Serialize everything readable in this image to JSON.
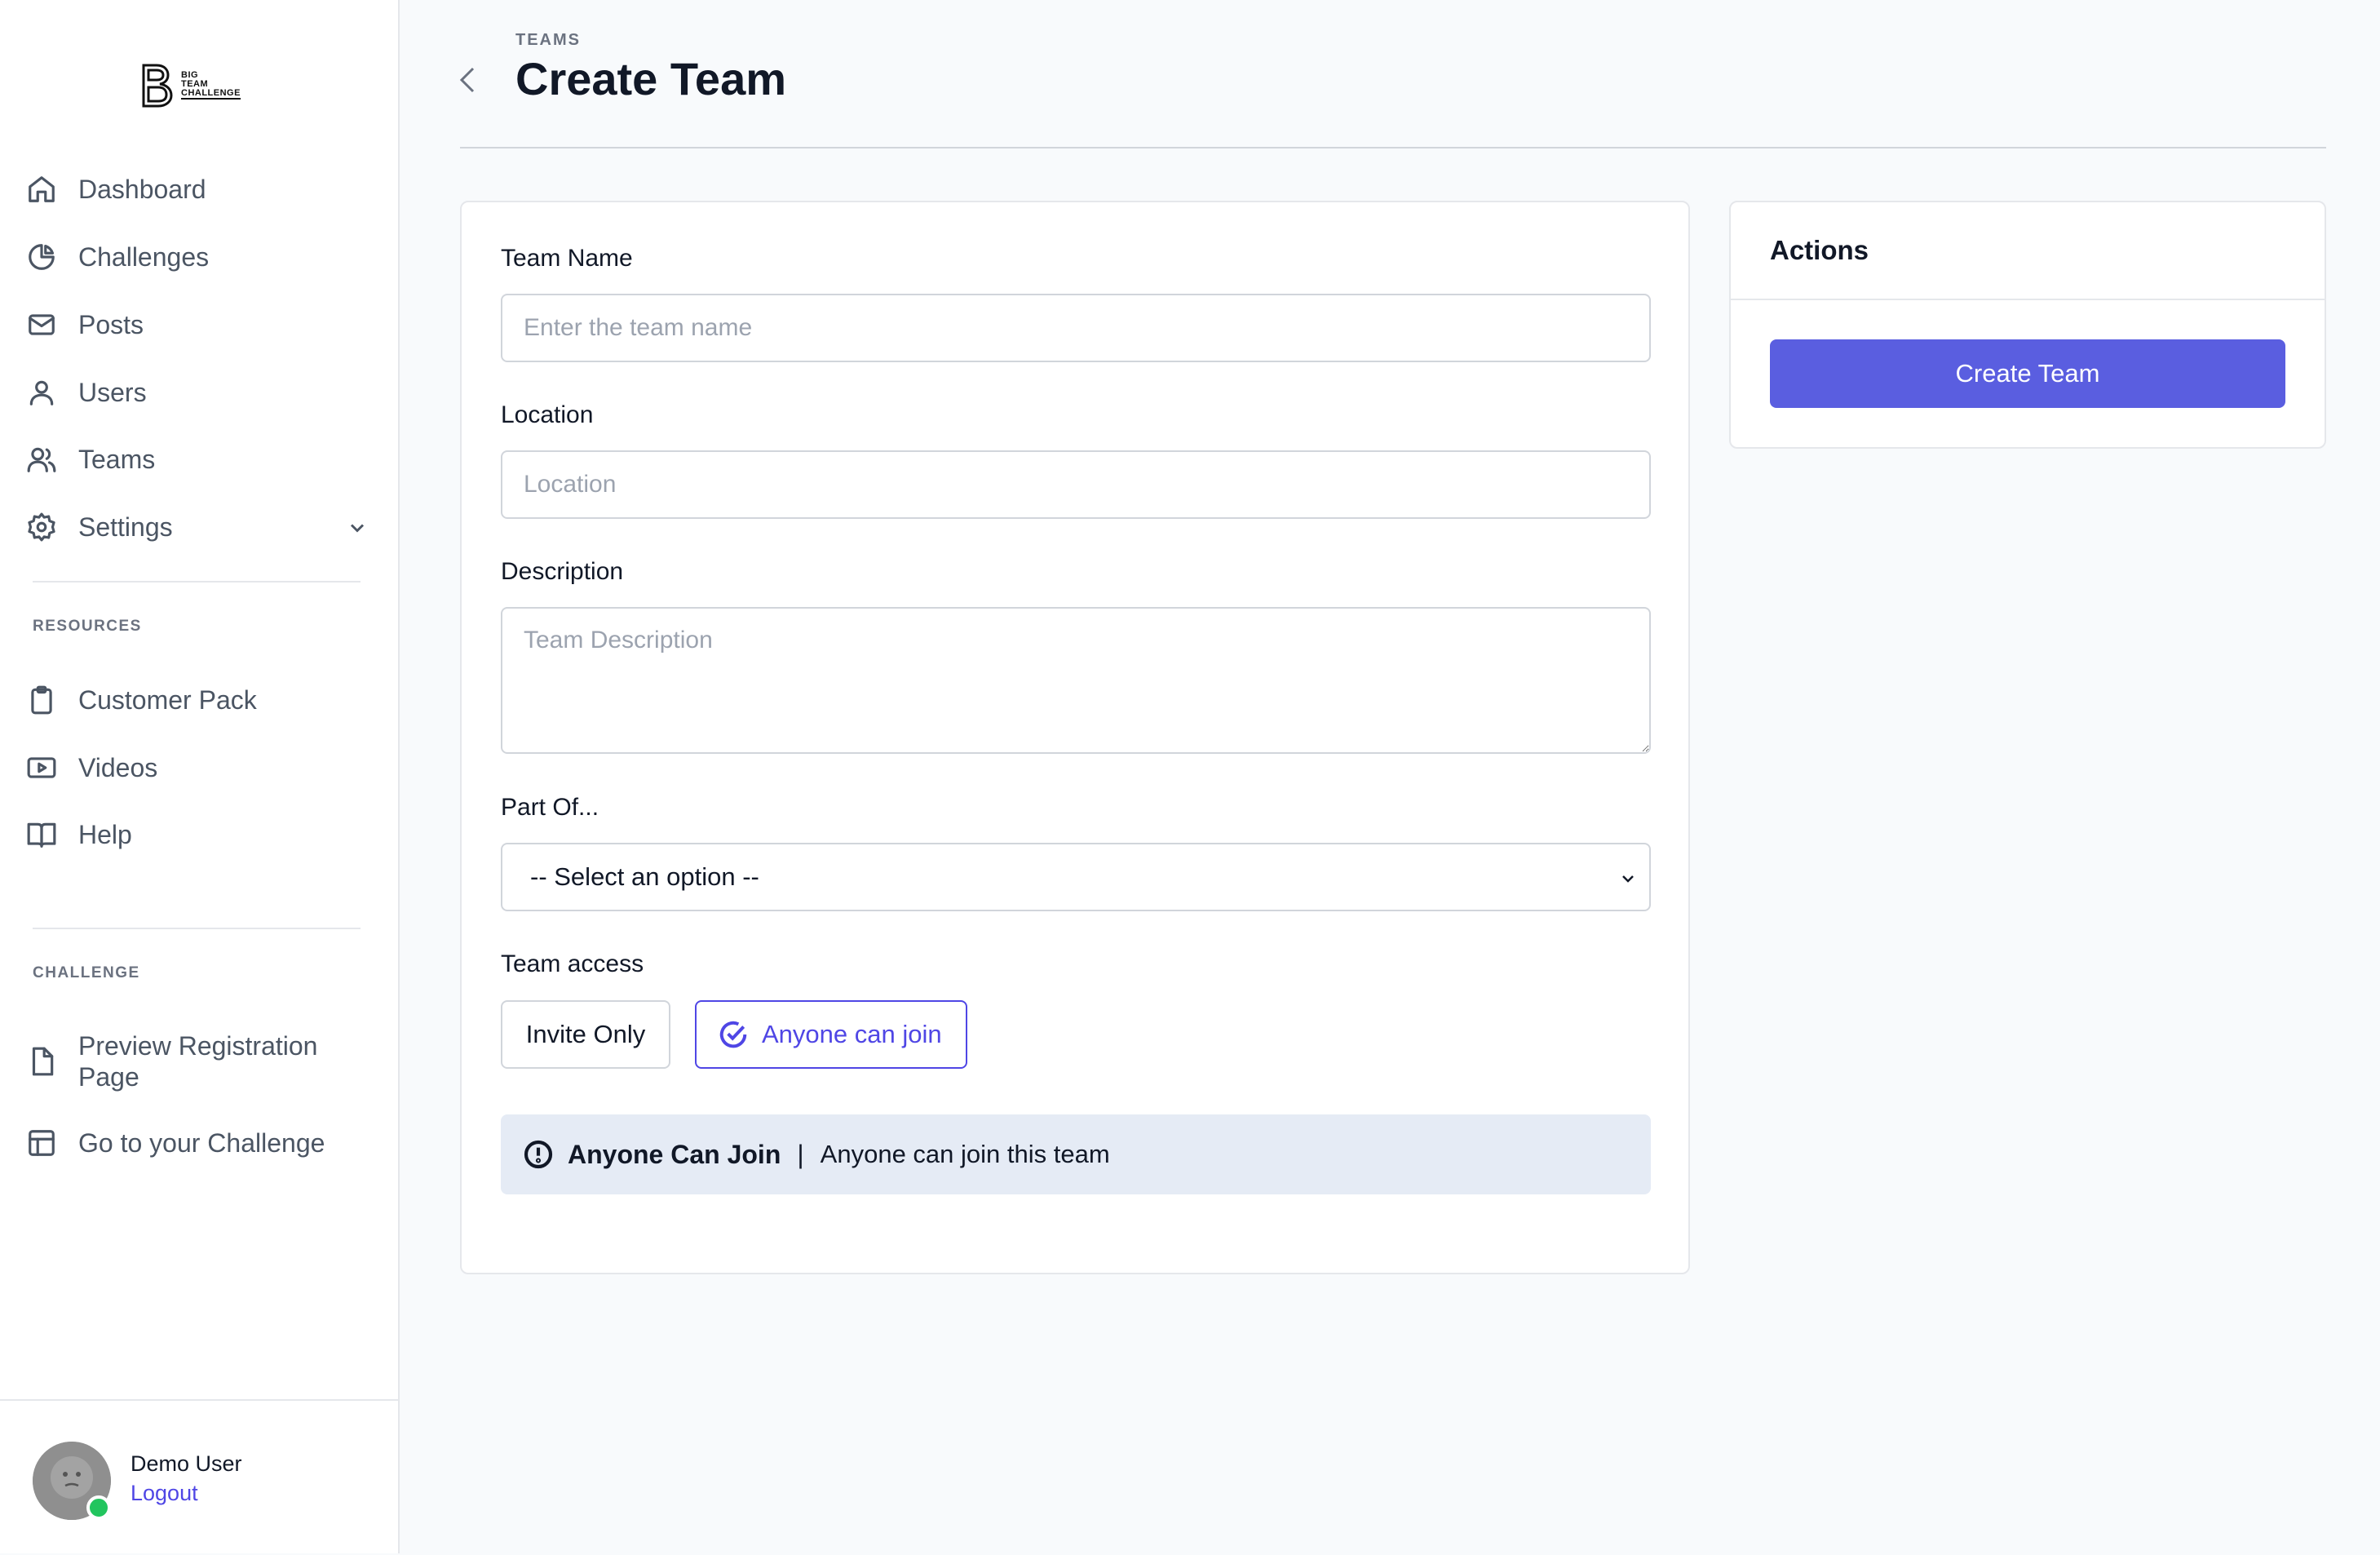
{
  "brand": {
    "logo_lines": [
      "BIG",
      "TEAM",
      "CHALLENGE"
    ]
  },
  "sidebar": {
    "main_items": [
      {
        "label": "Dashboard",
        "icon": "home-icon"
      },
      {
        "label": "Challenges",
        "icon": "pie-chart-icon"
      },
      {
        "label": "Posts",
        "icon": "mail-icon"
      },
      {
        "label": "Users",
        "icon": "user-icon"
      },
      {
        "label": "Teams",
        "icon": "users-icon"
      },
      {
        "label": "Settings",
        "icon": "gear-icon"
      }
    ],
    "resources_label": "RESOURCES",
    "resources_items": [
      {
        "label": "Customer Pack",
        "icon": "clipboard-icon"
      },
      {
        "label": "Videos",
        "icon": "video-icon"
      },
      {
        "label": "Help",
        "icon": "book-icon"
      }
    ],
    "challenge_label": "CHALLENGE",
    "challenge_items": [
      {
        "label": "Preview Registration Page",
        "icon": "file-icon"
      },
      {
        "label": "Go to your Challenge",
        "icon": "layout-icon"
      }
    ]
  },
  "user": {
    "name": "Demo User",
    "logout_label": "Logout"
  },
  "header": {
    "breadcrumb": "TEAMS",
    "title": "Create Team"
  },
  "form": {
    "team_name": {
      "label": "Team Name",
      "placeholder": "Enter the team name",
      "value": ""
    },
    "location": {
      "label": "Location",
      "placeholder": "Location",
      "value": ""
    },
    "description": {
      "label": "Description",
      "placeholder": "Team Description",
      "value": ""
    },
    "part_of": {
      "label": "Part Of...",
      "selected": "-- Select an option --"
    },
    "team_access": {
      "label": "Team access",
      "options": [
        "Invite Only",
        "Anyone can join"
      ],
      "selected": "Anyone can join"
    },
    "notice": {
      "title": "Anyone Can Join",
      "separator": "|",
      "text": "Anyone can join this team"
    }
  },
  "actions": {
    "title": "Actions",
    "create_label": "Create Team"
  },
  "colors": {
    "accent": "#4f46e5",
    "button": "#5a5ee0",
    "notice_bg": "#e5ebf5",
    "online": "#22c55e"
  }
}
